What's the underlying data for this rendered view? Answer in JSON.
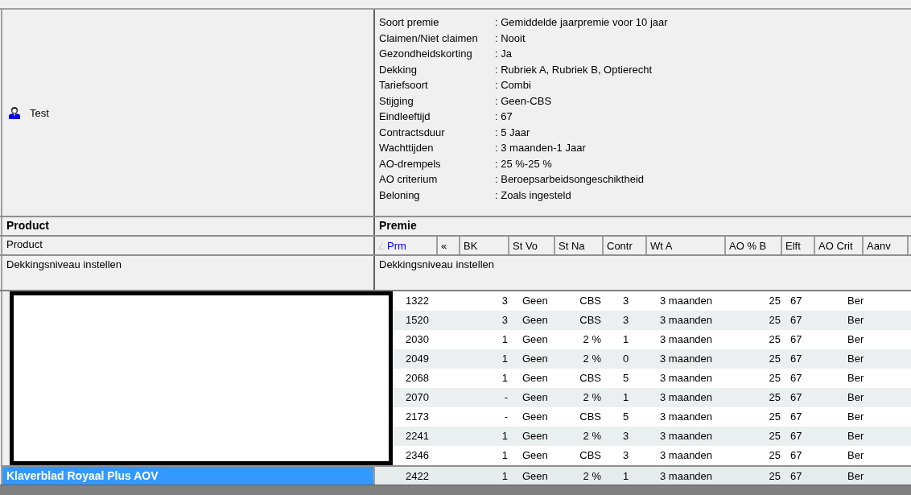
{
  "customer": {
    "name": "Test"
  },
  "summary": [
    {
      "label": "Soort premie",
      "value": ": Gemiddelde jaarpremie voor 10 jaar"
    },
    {
      "label": "Claimen/Niet claimen",
      "value": ": Nooit"
    },
    {
      "label": "Gezondheidskorting",
      "value": ": Ja"
    },
    {
      "label": "Dekking",
      "value": ": Rubriek A, Rubriek B, Optierecht"
    },
    {
      "label": "Tariefsoort",
      "value": ": Combi"
    },
    {
      "label": "Stijging",
      "value": ": Geen-CBS"
    },
    {
      "label": "Eindleeftijd",
      "value": ": 67"
    },
    {
      "label": "Contractsduur",
      "value": ": 5 Jaar"
    },
    {
      "label": "Wachttijden",
      "value": ": 3 maanden-1 Jaar"
    },
    {
      "label": "AO-drempels",
      "value": ": 25 %-25 %"
    },
    {
      "label": "AO criterium",
      "value": ": Beroepsarbeidsongeschiktheid"
    },
    {
      "label": "Beloning",
      "value": ": Zoals ingesteld"
    }
  ],
  "groups": {
    "left": "Product",
    "right": "Premie"
  },
  "left_column": {
    "label": "Product"
  },
  "columns": [
    {
      "label": "Prm",
      "sorted": true
    },
    {
      "label": "«",
      "sorted": false
    },
    {
      "label": "BK",
      "sorted": false
    },
    {
      "label": "St Vo",
      "sorted": false
    },
    {
      "label": "St Na",
      "sorted": false
    },
    {
      "label": "Contr",
      "sorted": false
    },
    {
      "label": "Wt A",
      "sorted": false
    },
    {
      "label": "AO % B",
      "sorted": false
    },
    {
      "label": "Elft",
      "sorted": false
    },
    {
      "label": "AO Crit",
      "sorted": false
    },
    {
      "label": "Aanv",
      "sorted": false
    }
  ],
  "filter_row": {
    "left": "Dekkingsniveau instellen",
    "right": "Dekkingsniveau instellen"
  },
  "rows": [
    {
      "selected": false,
      "cells": [
        "1322",
        "",
        "3",
        "Geen",
        "CBS",
        "3",
        "3 maanden",
        "25",
        "67",
        "Ber",
        ""
      ]
    },
    {
      "selected": false,
      "cells": [
        "1520",
        "",
        "3",
        "Geen",
        "CBS",
        "3",
        "3 maanden",
        "25",
        "67",
        "Ber",
        ""
      ]
    },
    {
      "selected": false,
      "cells": [
        "2030",
        "",
        "1",
        "Geen",
        "2 %",
        "1",
        "3 maanden",
        "25",
        "67",
        "Ber",
        ""
      ]
    },
    {
      "selected": false,
      "cells": [
        "2049",
        "",
        "1",
        "Geen",
        "2 %",
        "0",
        "3 maanden",
        "25",
        "67",
        "Ber",
        ""
      ]
    },
    {
      "selected": false,
      "cells": [
        "2068",
        "",
        "1",
        "Geen",
        "CBS",
        "5",
        "3 maanden",
        "25",
        "67",
        "Ber",
        ""
      ]
    },
    {
      "selected": false,
      "cells": [
        "2070",
        "",
        "-",
        "Geen",
        "2 %",
        "1",
        "3 maanden",
        "25",
        "67",
        "Ber",
        ""
      ]
    },
    {
      "selected": false,
      "cells": [
        "2173",
        "",
        "-",
        "Geen",
        "CBS",
        "5",
        "3 maanden",
        "25",
        "67",
        "Ber",
        ""
      ]
    },
    {
      "selected": false,
      "cells": [
        "2241",
        "",
        "1",
        "Geen",
        "2 %",
        "3",
        "3 maanden",
        "25",
        "67",
        "Ber",
        ""
      ]
    },
    {
      "selected": false,
      "cells": [
        "2346",
        "",
        "1",
        "Geen",
        "CBS",
        "3",
        "3 maanden",
        "25",
        "67",
        "Ber",
        ""
      ]
    },
    {
      "selected": true,
      "product": "Klaverblad Royaal Plus AOV",
      "cells": [
        "2422",
        "",
        "1",
        "Geen",
        "2 %",
        "1",
        "3 maanden",
        "25",
        "67",
        "Ber",
        ""
      ]
    }
  ]
}
